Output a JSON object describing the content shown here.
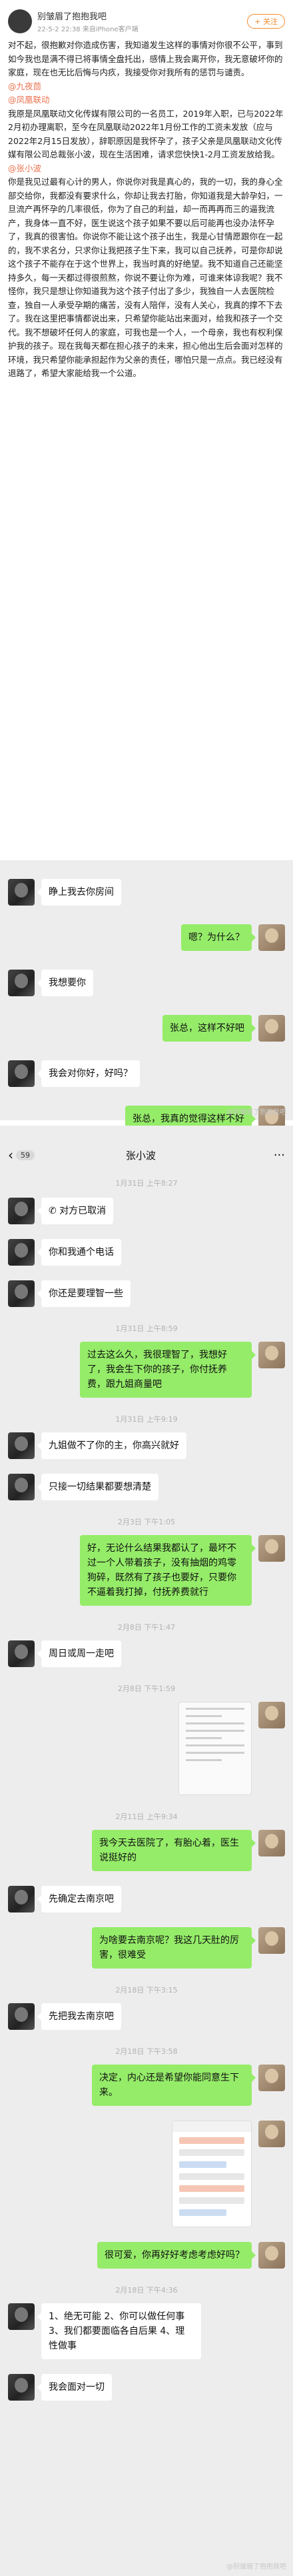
{
  "post": {
    "username": "别皱眉了抱抱我吧",
    "meta": "22-5-2 22:38  来自iPhone客户端",
    "follow_label": "+ 关注",
    "intro": "对不起，很抱歉对你造成伤害，我知道发生这样的事情对你很不公平，事到如今我也是满不得已将事情全盘托出，感情上我会离开你，我无意破坏你的家庭，现在也无比后悔与内疚，我接受你对我所有的惩罚与谴责。",
    "mention_1": "@九夜茴",
    "mention_2": "@凤凰联动",
    "para_2": "我原是凤凰联动文化传媒有限公司的一名员工，2019年入职，已与2022年2月初办理离职，至今在凤凰联动2022年1月份工作的工资未发放（应与2022年2月15日发放），辞职原因是我怀孕了，孩子父亲是凤凰联动文化传媒有限公司总裁张小波，现在生活困难，请求您快快1-2月工资发放给我。",
    "mention_3": "@张小波",
    "para_3": "你是我见过最有心计的男人，你说你对我是真心的，我的一切，我的身心全部交给你，我都没有要求什么，你却让我去打胎，你知道我是大龄孕妇，一旦流产再怀孕的几率很低，你为了自己的利益，却一而再再而三的逼我流产，我身体一直不好，医生说这个孩子如果不要以后可能再也没办法怀孕了，我真的很害怕。你说你不能让这个孩子出生，我是心甘情愿跟你在一起的，我不求名分，只求你让我把孩子生下来，我可以自己抚养，可是你却说这个孩子不能存在于这个世界上，我当时真的好绝望。我不知道自己还能坚持多久，每一天都过得很煎熬，你说不要让你为难，可谁来体谅我呢？我不怪你，我只是想让你知道我为这个孩子付出了多少，我独自一人去医院检查，独自一人承受孕期的痛苦，没有人陪伴，没有人关心，我真的撑不下去了。我在这里把事情都说出来，只希望你能站出来面对，给我和孩子一个交代。我不想破坏任何人的家庭，可我也是一个人，一个母亲，我也有权利保护我的孩子。现在我每天都在担心孩子的未来，担心他出生后会面对怎样的环境，我只希望你能承担起作为父亲的责任，哪怕只是一点点。我已经没有退路了，希望大家能给我一个公道。"
  },
  "chat1": {
    "messages": [
      {
        "side": "left",
        "text": "睁上我去你房间"
      },
      {
        "side": "right",
        "text": "嗯？为什么？"
      },
      {
        "side": "left",
        "text": "我想要你"
      },
      {
        "side": "right",
        "text": "张总，这样不好吧"
      },
      {
        "side": "left",
        "text": "我会对你好，好吗？"
      },
      {
        "side": "right",
        "text": "张总，我真的觉得这样不好"
      }
    ],
    "watermark": "@别皱眉了抱抱我吧"
  },
  "chat2": {
    "status_time": "",
    "nav": {
      "back_icon": "‹",
      "badge": "59",
      "title": "张小波",
      "more_icon": "···"
    },
    "ts_1": "1月31日 上午8:27",
    "messages_a": [
      {
        "side": "left",
        "text": "对方已取消",
        "icon": "phone-icon"
      },
      {
        "side": "left",
        "text": "你和我通个电话"
      },
      {
        "side": "left",
        "text": "你还是要理智一些"
      }
    ],
    "ts_2": "1月31日 上午8:59",
    "msg_long_1": "过去这么久，我很理智了，我想好了，我会生下你的孩子，你付抚养费，跟九姐商量吧",
    "ts_3": "1月31日 上午9:19",
    "messages_b": [
      {
        "side": "left",
        "text": "九姐做不了你的主，你高兴就好"
      },
      {
        "side": "left",
        "text": "只接一切结果都要想清楚"
      }
    ],
    "ts_4": "2月3日 下午1:05",
    "msg_long_2": "好，无论什么结果我都认了，最坏不过一个人带着孩子，没有抽烟的鸡零狗碎，既然有了孩子也要好，只要你不逼着我打掉，付抚养费就行",
    "ts_5": "2月8日 下午1:47",
    "msg_c": "周日或周一走吧",
    "ts_6": "2月8日 下午1:59",
    "photo_label": "",
    "ts_7": "2月11日 上午9:34",
    "msg_d": "我今天去医院了，有胎心着，医生说挺好的",
    "msg_e": "先确定去南京吧",
    "msg_f": "为啥要去南京呢？我这几天肚的厉害，很难受",
    "ts_8": "2月18日 下午3:15",
    "msg_g": "先把我去南京吧",
    "ts_9": "2月18日 下午3:58",
    "msg_h": "决定，内心还是希望你能同意生下来。",
    "msg_i": "很可爱，你再好好考虑考虑好吗？",
    "ts_10": "2月18日 下午4:36",
    "msg_j": "1、绝无可能 2、你可以做任何事 3、我们都要面临各自后果 4、理性做事",
    "msg_k": "我会面对一切",
    "watermark": "@别皱眉了抱抱我吧"
  }
}
